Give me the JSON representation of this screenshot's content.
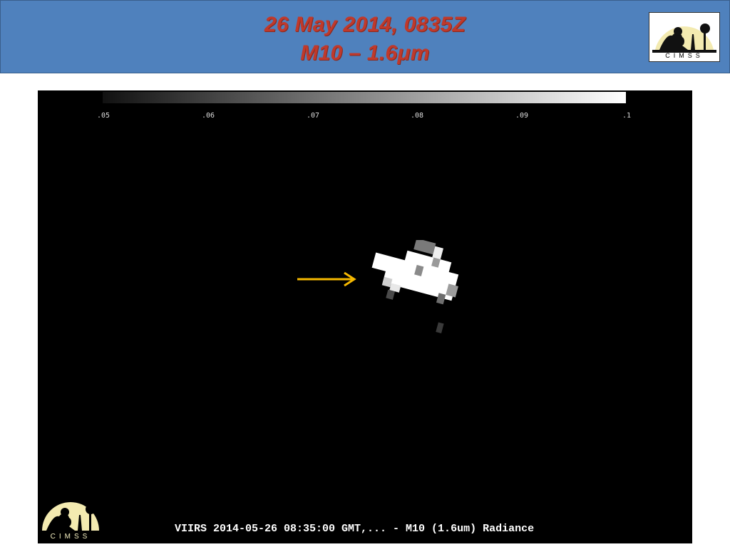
{
  "header": {
    "title_line1": "26 May 2014, 0835Z",
    "title_line2": "M10 – 1.6μm",
    "logo_text": "CIMSS"
  },
  "colorbar": {
    "ticks": [
      ".05",
      ".06",
      ".07",
      ".08",
      ".09",
      ".1"
    ]
  },
  "image": {
    "caption": "VIIRS 2014-05-26 08:35:00 GMT,... - M10 (1.6um) Radiance",
    "logo_text": "CIMSS"
  },
  "colors": {
    "header_bg": "#4f81bd",
    "title_color": "#c0392b",
    "arrow_color": "#f5b800"
  }
}
